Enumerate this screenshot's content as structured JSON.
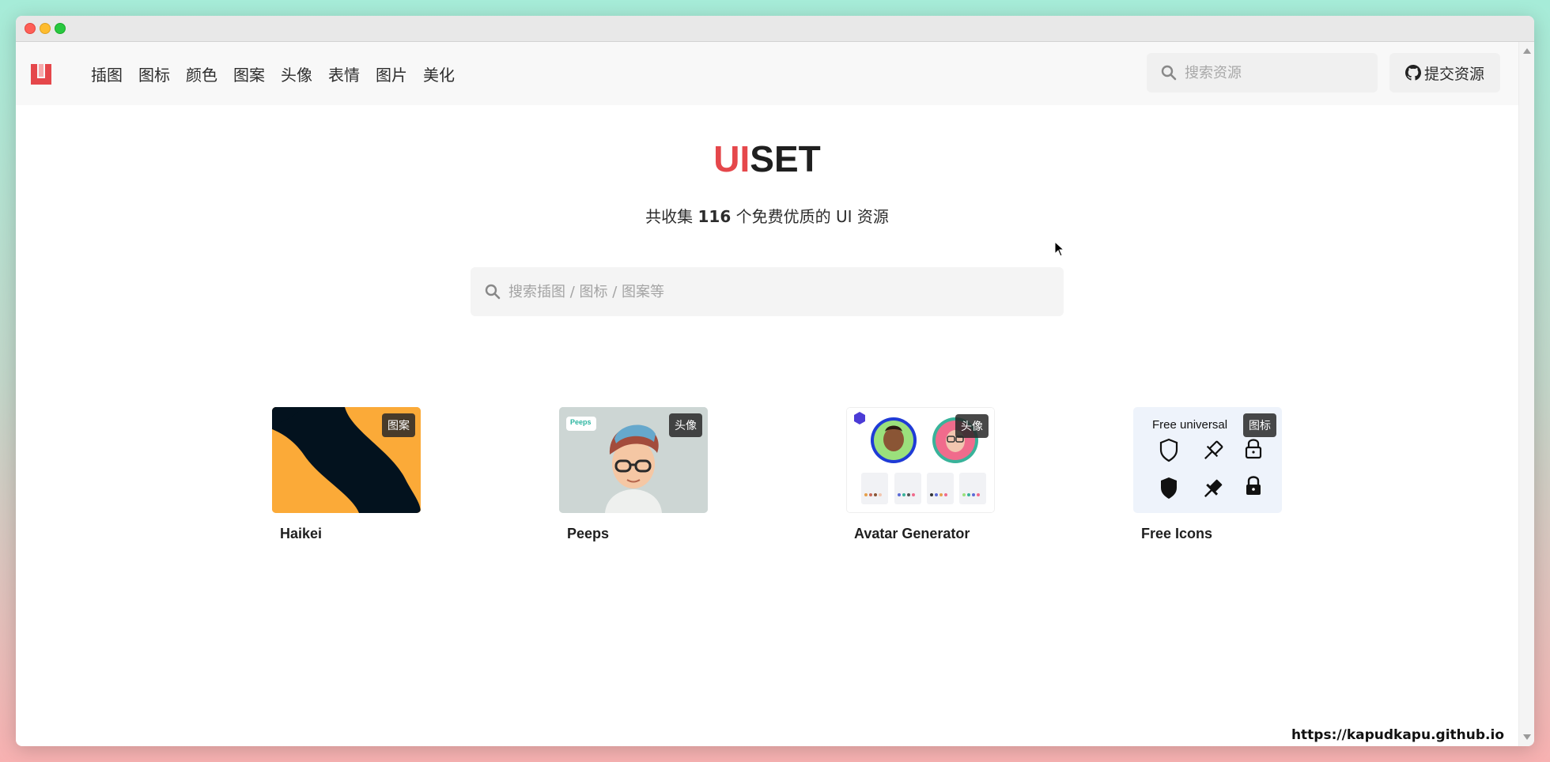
{
  "nav": {
    "items": [
      {
        "label": "插图"
      },
      {
        "label": "图标"
      },
      {
        "label": "颜色"
      },
      {
        "label": "图案"
      },
      {
        "label": "头像"
      },
      {
        "label": "表情"
      },
      {
        "label": "图片"
      },
      {
        "label": "美化"
      }
    ],
    "search_placeholder": "搜索资源",
    "submit_label": "提交资源"
  },
  "hero": {
    "brand_ui": "UI",
    "brand_set": "SET",
    "tagline_prefix": "共收集 ",
    "count": "116",
    "tagline_suffix": " 个免费优质的 UI 资源",
    "search_placeholder": "搜索插图 / 图标 / 图案等"
  },
  "cards": [
    {
      "title": "Haikei",
      "badge": "图案"
    },
    {
      "title": "Peeps",
      "badge": "头像",
      "thumb_label": "Peeps"
    },
    {
      "title": "Avatar Generator",
      "badge": "头像"
    },
    {
      "title": "Free Icons",
      "badge": "图标",
      "thumb_text": "Free universal"
    }
  ],
  "footer": {
    "url": "https://kapudkapu.github.io"
  },
  "colors": {
    "accent": "#e5474b",
    "haikei_yellow": "#fbaa38",
    "haikei_navy": "#03121e"
  }
}
